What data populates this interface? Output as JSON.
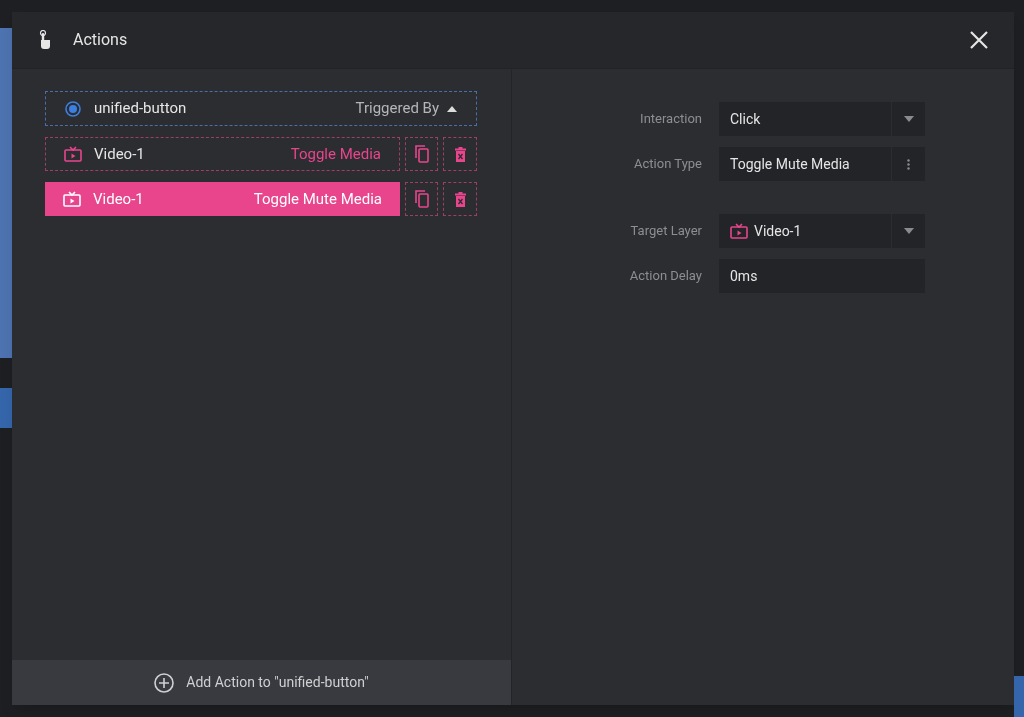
{
  "dialog": {
    "title": "Actions"
  },
  "trigger": {
    "name": "unified-button",
    "label": "Triggered By",
    "expanded": true
  },
  "actions": [
    {
      "layer": "Video-1",
      "action": "Toggle Media",
      "selected": false
    },
    {
      "layer": "Video-1",
      "action": "Toggle Mute Media",
      "selected": true
    }
  ],
  "add_button": "Add Action to \"unified-button\"",
  "settings": [
    {
      "kind": "select",
      "label": "Interaction",
      "value": "Click"
    },
    {
      "kind": "menu",
      "label": "Action Type",
      "value": "Toggle Mute Media"
    },
    {
      "kind": "layer",
      "label": "Target Layer",
      "value": "Video-1"
    },
    {
      "kind": "input",
      "label": "Action Delay",
      "value": "0ms"
    }
  ]
}
